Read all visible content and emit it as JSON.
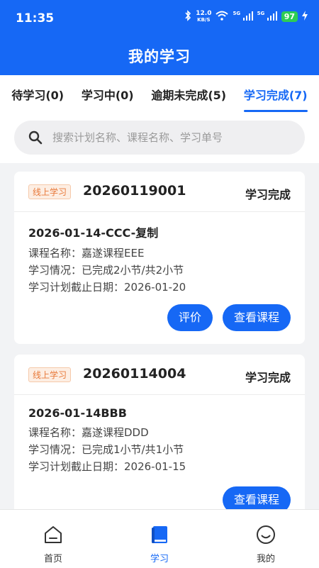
{
  "status_bar": {
    "time": "11:35",
    "net_speed_value": "12.0",
    "net_speed_unit": "KB/S",
    "sim1_label": "5G",
    "sim2_label": "5G",
    "battery": "97"
  },
  "header": {
    "title": "我的学习"
  },
  "tabs": [
    {
      "label": "待学习(0)",
      "active": false
    },
    {
      "label": "学习中(0)",
      "active": false
    },
    {
      "label": "逾期未完成(5)",
      "active": false
    },
    {
      "label": "学习完成(7)",
      "active": true
    }
  ],
  "search": {
    "placeholder": "搜索计划名称、课程名称、学习单号",
    "value": ""
  },
  "cards": [
    {
      "tag": "线上学习",
      "code": "20260119001",
      "status": "学习完成",
      "plan_name": "2026-01-14-CCC-复制",
      "course": "课程名称：嘉遂课程EEE",
      "progress": "学习情况：已完成2小节/共2小节",
      "deadline": "学习计划截止日期：2026-01-20",
      "btn_rate": "评价",
      "btn_view": "查看课程"
    },
    {
      "tag": "线上学习",
      "code": "20260114004",
      "status": "学习完成",
      "plan_name": "2026-01-14BBB",
      "course": "课程名称：嘉遂课程DDD",
      "progress": "学习情况：已完成1小节/共1小节",
      "deadline": "学习计划截止日期：2026-01-15",
      "btn_view": "查看课程"
    }
  ],
  "bottom_nav": [
    {
      "label": "首页",
      "icon": "home-icon",
      "active": false
    },
    {
      "label": "学习",
      "icon": "book-icon",
      "active": true
    },
    {
      "label": "我的",
      "icon": "smile-icon",
      "active": false
    }
  ],
  "colors": {
    "primary": "#1668f5",
    "tag_orange": "#e8793a",
    "background": "#f2f3f5"
  }
}
